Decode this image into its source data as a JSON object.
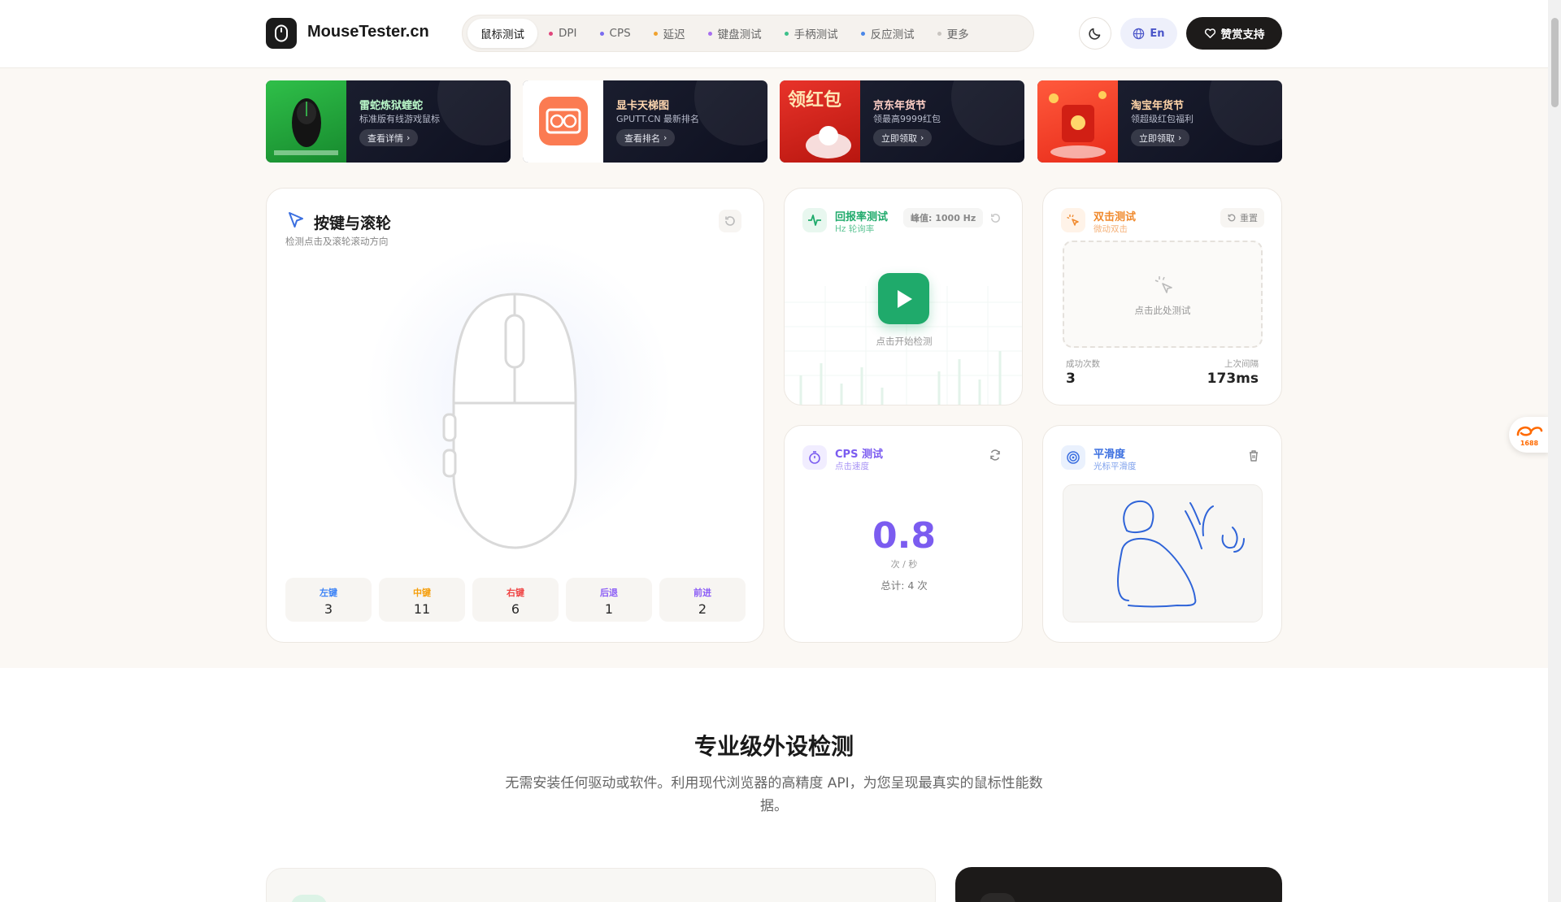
{
  "header": {
    "logo_text": "MouseTester.cn",
    "nav": [
      {
        "label": "鼠标测试",
        "active": true,
        "dot": ""
      },
      {
        "label": "DPI",
        "dot": "#e0457b"
      },
      {
        "label": "CPS",
        "dot": "#7b6cf0"
      },
      {
        "label": "延迟",
        "dot": "#f0a22e"
      },
      {
        "label": "键盘测试",
        "dot": "#a86ff0"
      },
      {
        "label": "手柄测试",
        "dot": "#3cc08a"
      },
      {
        "label": "反应测试",
        "dot": "#4a87e8"
      },
      {
        "label": "更多",
        "dot": "#c9c5c0"
      }
    ],
    "lang_label": "En",
    "support_label": "赞赏支持"
  },
  "banners": [
    {
      "title": "雷蛇炼狱蝰蛇",
      "subtitle": "标准版有线游戏鼠标",
      "button": "查看详情"
    },
    {
      "title": "显卡天梯图",
      "subtitle": "GPUTT.CN 最新排名",
      "button": "查看排名"
    },
    {
      "title": "京东年货节",
      "subtitle": "领最高9999红包",
      "button": "立即领取",
      "image_text": "领红包"
    },
    {
      "title": "淘宝年货节",
      "subtitle": "领超级红包福利",
      "button": "立即领取"
    }
  ],
  "buttons_card": {
    "title": "按键与滚轮",
    "subtitle": "检测点击及滚轮滚动方向",
    "stats": [
      {
        "label": "左键",
        "value": "3",
        "color": "#3b82f6"
      },
      {
        "label": "中键",
        "value": "11",
        "color": "#f59e0b"
      },
      {
        "label": "右键",
        "value": "6",
        "color": "#ef4444"
      },
      {
        "label": "后退",
        "value": "1",
        "color": "#8b5cf6"
      },
      {
        "label": "前进",
        "value": "2",
        "color": "#8b5cf6"
      }
    ]
  },
  "polling_card": {
    "title": "回报率测试",
    "subtitle": "Hz 轮询率",
    "peak_label": "峰值: 1000 Hz",
    "start_label": "点击开始检测"
  },
  "double_click_card": {
    "title": "双击测试",
    "subtitle": "微动双击",
    "reset_label": "重置",
    "area_label": "点击此处测试",
    "success_label": "成功次数",
    "success_value": "3",
    "interval_label": "上次间隔",
    "interval_value": "173ms"
  },
  "cps_card": {
    "title": "CPS 测试",
    "subtitle": "点击速度",
    "value": "0.8",
    "unit": "次 / 秒",
    "total": "总计: 4 次"
  },
  "smooth_card": {
    "title": "平滑度",
    "subtitle": "光标平滑度"
  },
  "section": {
    "title": "专业级外设检测",
    "description": "无需安装任何驱动或软件。利用现代浏览器的高精度 API，为您呈现最真实的鼠标性能数据。"
  },
  "colors": {
    "accent_green": "#1faa6b",
    "accent_purple": "#7b5cf0",
    "accent_orange": "#f08a2e",
    "accent_blue": "#3b6fe0"
  },
  "side_widget_label": "1688"
}
